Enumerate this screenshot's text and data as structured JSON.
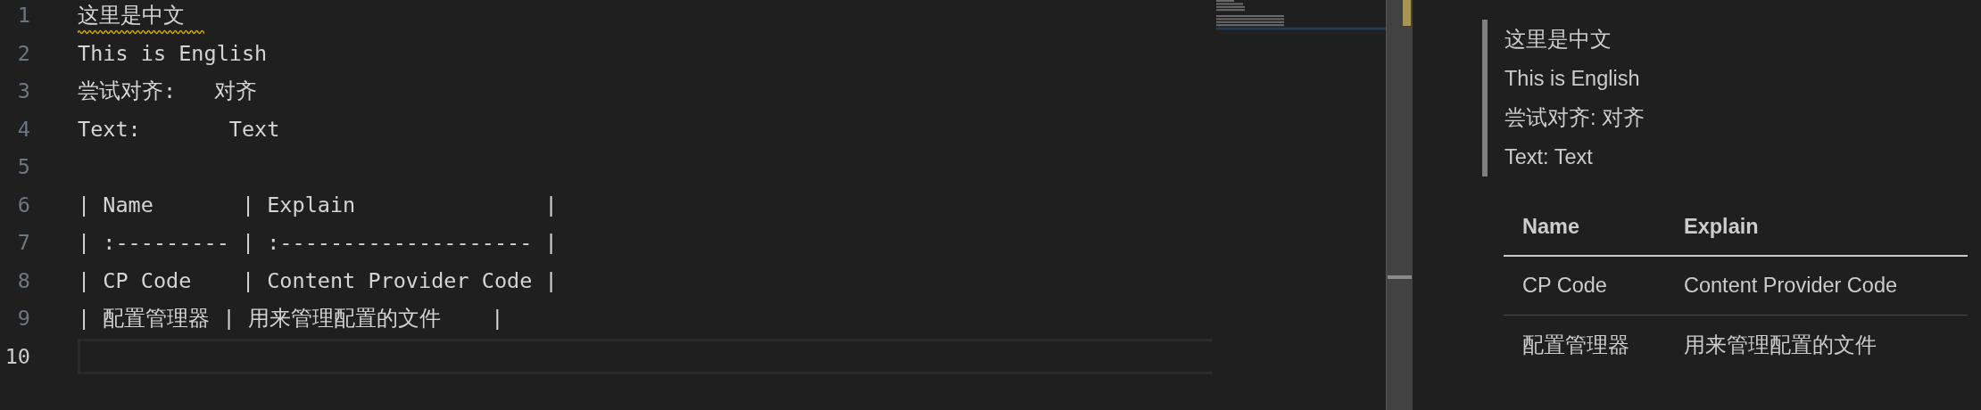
{
  "editor": {
    "lines": [
      {
        "number": "1",
        "text": "这里是中文",
        "warning": true,
        "current": false
      },
      {
        "number": "2",
        "text": "This is English",
        "warning": false,
        "current": false
      },
      {
        "number": "3",
        "text": "尝试对齐:   对齐",
        "warning": false,
        "current": false
      },
      {
        "number": "4",
        "text": "Text:       Text",
        "warning": false,
        "current": false
      },
      {
        "number": "5",
        "warning": false,
        "current": false
      },
      {
        "number": "6",
        "text": "| Name       | Explain               |",
        "warning": false,
        "current": false
      },
      {
        "number": "7",
        "text": "| :--------- | :-------------------- |",
        "warning": false,
        "current": false
      },
      {
        "number": "8",
        "text": "| CP Code    | Content Provider Code |",
        "warning": false,
        "current": false
      },
      {
        "number": "9",
        "text": "| 配置管理器 | 用来管理配置的文件    |",
        "warning": false,
        "current": false
      },
      {
        "number": "10",
        "warning": false,
        "current": true
      }
    ]
  },
  "preview": {
    "blockquote": [
      "这里是中文",
      "This is English",
      "尝试对齐: 对齐",
      "Text: Text"
    ],
    "table": {
      "columns": [
        "Name",
        "Explain"
      ],
      "rows": [
        [
          "CP Code",
          "Content Provider Code"
        ],
        [
          "配置管理器",
          "用来管理配置的文件"
        ]
      ]
    }
  }
}
